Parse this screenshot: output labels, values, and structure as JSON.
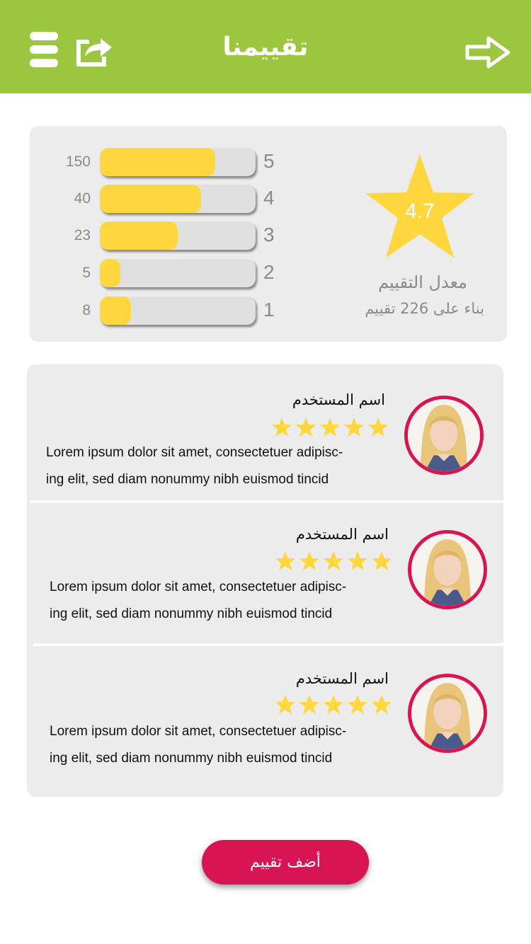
{
  "header": {
    "title": "تقييمنا",
    "background": "#9cc63f",
    "icons": {
      "menu": "menu-icon",
      "share": "share-icon",
      "forward": "arrow-right-icon"
    }
  },
  "summary": {
    "average": "4.7",
    "average_label": "معدل التقييم",
    "based_on": "بناء على 226 تقييم",
    "bars": [
      {
        "label": "5",
        "count": "150",
        "fill": 0.74
      },
      {
        "label": "4",
        "count": "40",
        "fill": 0.65
      },
      {
        "label": "3",
        "count": "23",
        "fill": 0.5
      },
      {
        "label": "2",
        "count": "5",
        "fill": 0.13
      },
      {
        "label": "1",
        "count": "8",
        "fill": 0.2
      }
    ],
    "accent": "#fed63e"
  },
  "reviews": [
    {
      "name": "اسم المستخدم",
      "rating": 5,
      "text_line1": "Lorem ipsum dolor sit amet, consectetuer adipisc-",
      "text_line2": "ing elit, sed diam nonummy nibh euismod tincid"
    },
    {
      "name": "اسم المستخدم",
      "rating": 5,
      "text_line1": "Lorem ipsum dolor sit amet, consectetuer adipisc-",
      "text_line2": "ing elit, sed diam nonummy nibh euismod tincid"
    },
    {
      "name": "اسم المستخدم",
      "rating": 5,
      "text_line1": "Lorem ipsum dolor sit amet, consectetuer adipisc-",
      "text_line2": "ing elit, sed diam nonummy nibh euismod tincid"
    }
  ],
  "add_button": {
    "label": "أضف تقييم",
    "color": "#d91453"
  }
}
